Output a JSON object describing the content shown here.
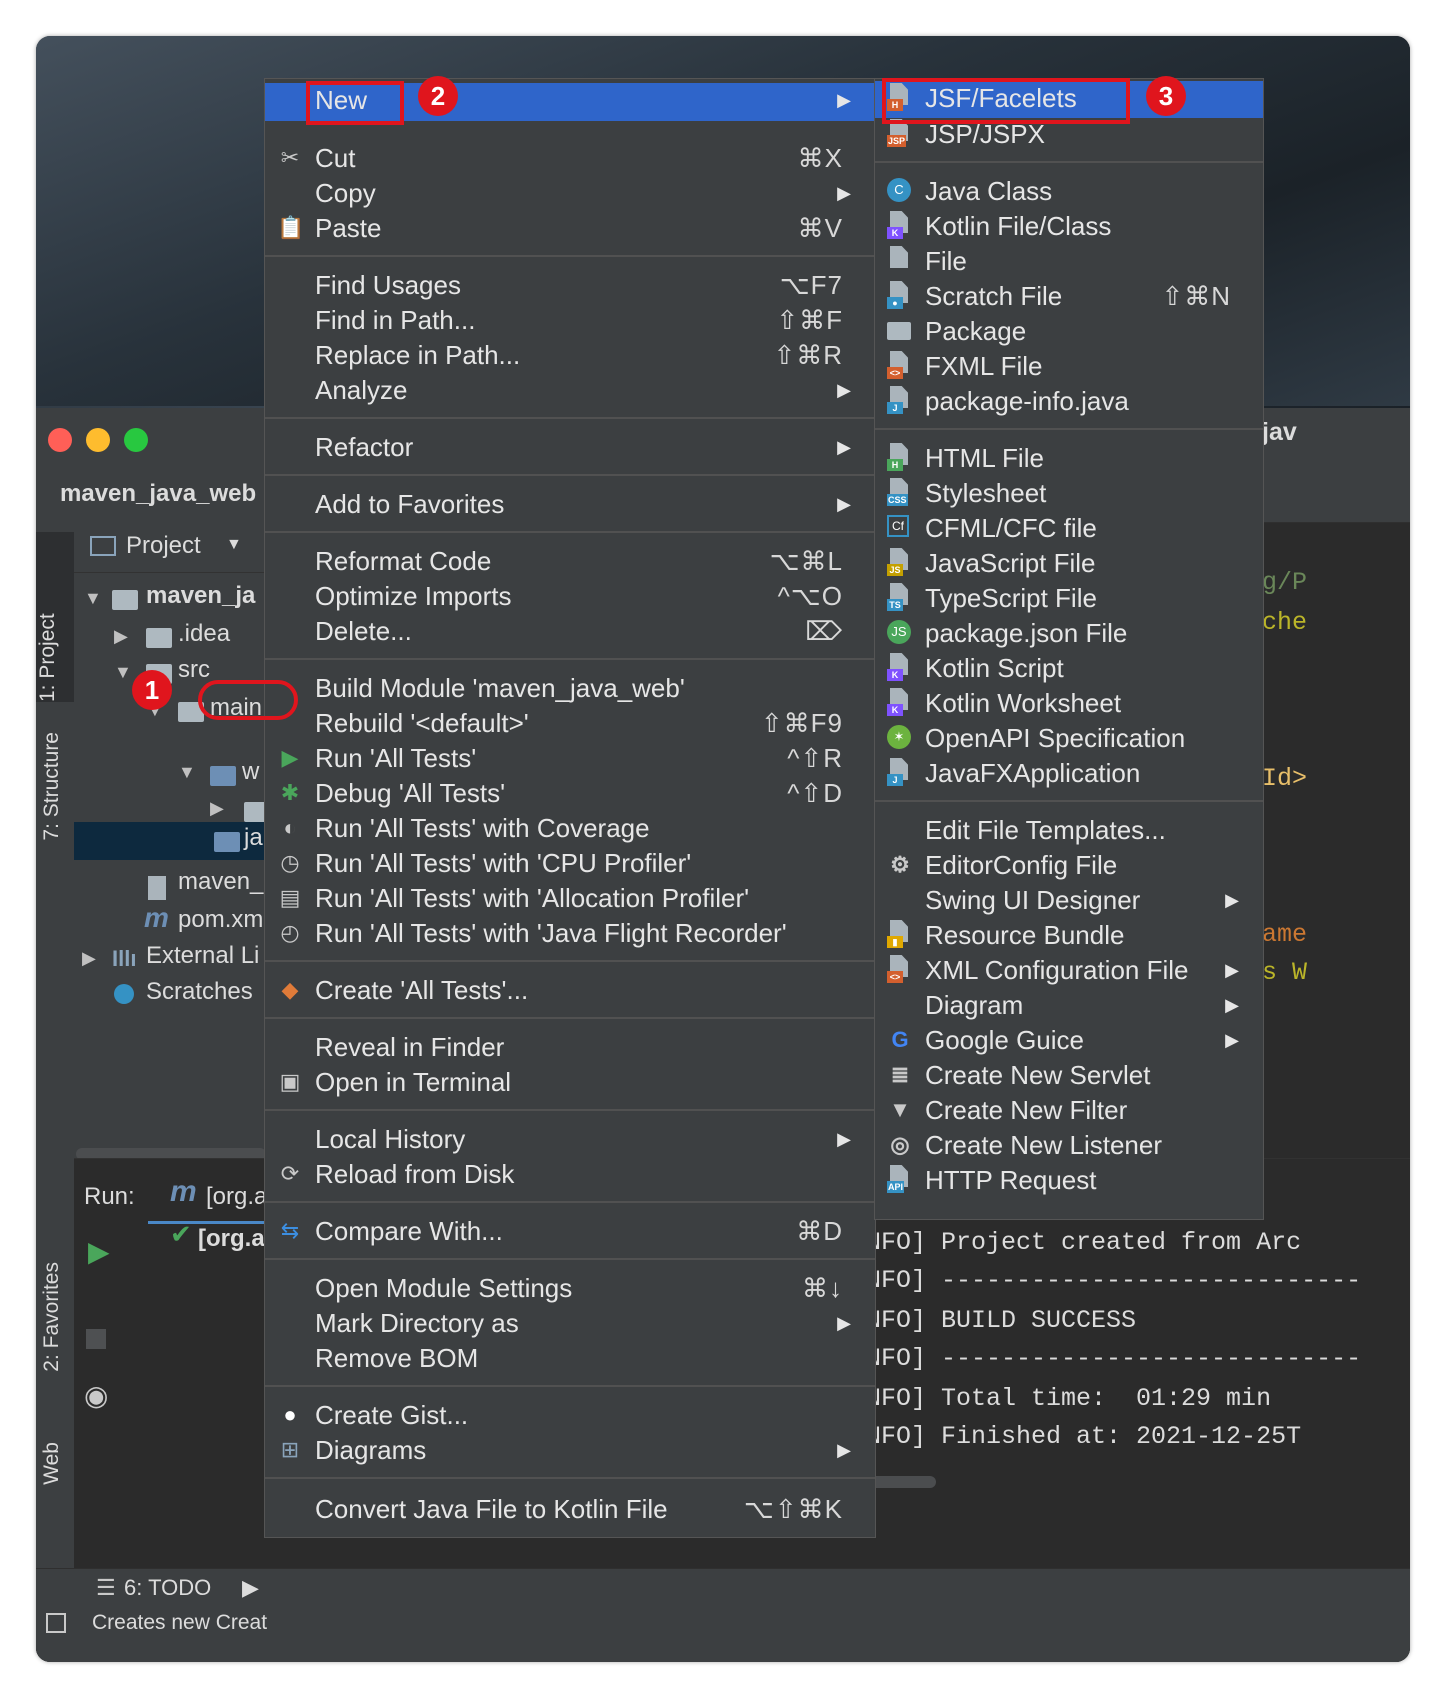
{
  "ide": {
    "project_crumb": "maven_java_web",
    "right_peek_title": "jav",
    "project_view_label": "Project",
    "side_tabs": [
      "1: Project",
      "7: Structure",
      "2: Favorites",
      "Web"
    ],
    "tree": {
      "root": "maven_ja",
      "idea": ".idea",
      "src": "src",
      "main": "main",
      "java_folder": "ja",
      "w_folder": "w",
      "maven_file": "maven_",
      "pom": "pom.xm",
      "external": "External Li",
      "scratches": "Scratches"
    },
    "run": {
      "label": "Run:",
      "tab": "[org.a",
      "item": "[org.a"
    },
    "bottom": {
      "todo": "6: TODO",
      "status": "Creates new Creat"
    },
    "code_peek": [
      "g/P",
      "che",
      "Id>",
      "ame",
      "s W"
    ],
    "console": [
      "NFO] Project created from Arc",
      "NFO] ----------------------------",
      "NFO] BUILD SUCCESS",
      "NFO] ----------------------------",
      "NFO] Total time:  01:29 min",
      "NFO] Finished at: 2021-12-25T"
    ]
  },
  "annotations": {
    "badge1": "1",
    "badge2": "2",
    "badge3": "3"
  },
  "context_menu": {
    "new": "New",
    "items": [
      {
        "label": "Cut",
        "shortcut": "⌘X"
      },
      {
        "label": "Copy",
        "shortcut": ""
      },
      {
        "label": "Paste",
        "shortcut": "⌘V"
      },
      {
        "label": "Find Usages",
        "shortcut": "⌥F7"
      },
      {
        "label": "Find in Path...",
        "shortcut": "⇧⌘F"
      },
      {
        "label": "Replace in Path...",
        "shortcut": "⇧⌘R"
      },
      {
        "label": "Analyze",
        "shortcut": ""
      },
      {
        "label": "Refactor",
        "shortcut": ""
      },
      {
        "label": "Add to Favorites",
        "shortcut": ""
      },
      {
        "label": "Reformat Code",
        "shortcut": "⌥⌘L"
      },
      {
        "label": "Optimize Imports",
        "shortcut": "^⌥O"
      },
      {
        "label": "Delete...",
        "shortcut": "⌦"
      },
      {
        "label": "Build Module 'maven_java_web'",
        "shortcut": ""
      },
      {
        "label": "Rebuild '<default>'",
        "shortcut": "⇧⌘F9"
      },
      {
        "label": "Run 'All Tests'",
        "shortcut": "^⇧R"
      },
      {
        "label": "Debug 'All Tests'",
        "shortcut": "^⇧D"
      },
      {
        "label": "Run 'All Tests' with Coverage",
        "shortcut": ""
      },
      {
        "label": "Run 'All Tests' with 'CPU Profiler'",
        "shortcut": ""
      },
      {
        "label": "Run 'All Tests' with 'Allocation Profiler'",
        "shortcut": ""
      },
      {
        "label": "Run 'All Tests' with 'Java Flight Recorder'",
        "shortcut": ""
      },
      {
        "label": "Create 'All Tests'...",
        "shortcut": ""
      },
      {
        "label": "Reveal in Finder",
        "shortcut": ""
      },
      {
        "label": "Open in Terminal",
        "shortcut": ""
      },
      {
        "label": "Local History",
        "shortcut": ""
      },
      {
        "label": "Reload from Disk",
        "shortcut": ""
      },
      {
        "label": "Compare With...",
        "shortcut": "⌘D"
      },
      {
        "label": "Open Module Settings",
        "shortcut": "⌘↓"
      },
      {
        "label": "Mark Directory as",
        "shortcut": ""
      },
      {
        "label": "Remove BOM",
        "shortcut": ""
      },
      {
        "label": "Create Gist...",
        "shortcut": ""
      },
      {
        "label": "Diagrams",
        "shortcut": ""
      },
      {
        "label": "Convert Java File to Kotlin File",
        "shortcut": "⌥⇧⌘K"
      }
    ]
  },
  "new_submenu": {
    "items": [
      {
        "label": "JSF/Facelets",
        "shortcut": ""
      },
      {
        "label": "JSP/JSPX",
        "shortcut": ""
      },
      {
        "label": "Java Class",
        "shortcut": ""
      },
      {
        "label": "Kotlin File/Class",
        "shortcut": ""
      },
      {
        "label": "File",
        "shortcut": ""
      },
      {
        "label": "Scratch File",
        "shortcut": "⇧⌘N"
      },
      {
        "label": "Package",
        "shortcut": ""
      },
      {
        "label": "FXML File",
        "shortcut": ""
      },
      {
        "label": "package-info.java",
        "shortcut": ""
      },
      {
        "label": "HTML File",
        "shortcut": ""
      },
      {
        "label": "Stylesheet",
        "shortcut": ""
      },
      {
        "label": "CFML/CFC file",
        "shortcut": ""
      },
      {
        "label": "JavaScript File",
        "shortcut": ""
      },
      {
        "label": "TypeScript File",
        "shortcut": ""
      },
      {
        "label": "package.json File",
        "shortcut": ""
      },
      {
        "label": "Kotlin Script",
        "shortcut": ""
      },
      {
        "label": "Kotlin Worksheet",
        "shortcut": ""
      },
      {
        "label": "OpenAPI Specification",
        "shortcut": ""
      },
      {
        "label": "JavaFXApplication",
        "shortcut": ""
      },
      {
        "label": "Edit File Templates...",
        "shortcut": ""
      },
      {
        "label": "EditorConfig File",
        "shortcut": ""
      },
      {
        "label": "Swing UI Designer",
        "shortcut": ""
      },
      {
        "label": "Resource Bundle",
        "shortcut": ""
      },
      {
        "label": "XML Configuration File",
        "shortcut": ""
      },
      {
        "label": "Diagram",
        "shortcut": ""
      },
      {
        "label": "Google Guice",
        "shortcut": ""
      },
      {
        "label": "Create New Servlet",
        "shortcut": ""
      },
      {
        "label": "Create New Filter",
        "shortcut": ""
      },
      {
        "label": "Create New Listener",
        "shortcut": ""
      },
      {
        "label": "HTTP Request",
        "shortcut": ""
      }
    ]
  },
  "colors": {
    "highlight": "#2f65ca",
    "annotation_red": "#e0151d",
    "menu_bg": "#3c3f41"
  }
}
